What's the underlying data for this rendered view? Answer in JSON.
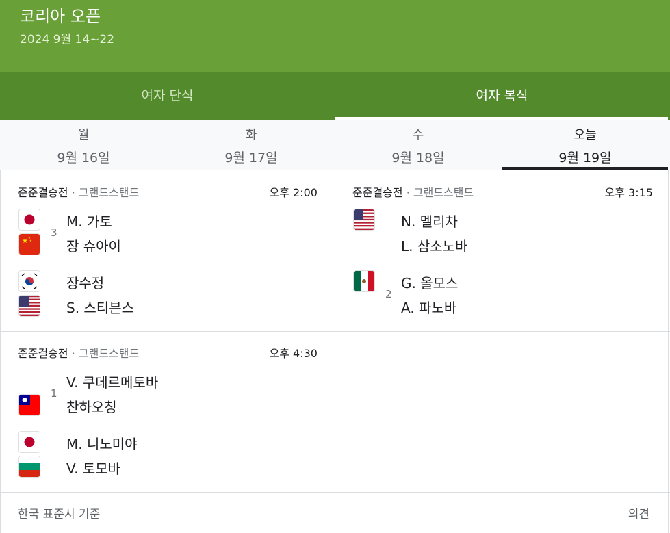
{
  "header": {
    "title": "코리아 오픈",
    "dates": "2024 9월 14~22"
  },
  "tabs": [
    {
      "label": "여자 단식",
      "active": false
    },
    {
      "label": "여자 복식",
      "active": true
    }
  ],
  "days": [
    {
      "name": "월",
      "date": "9월 16일",
      "active": false
    },
    {
      "name": "화",
      "date": "9월 17일",
      "active": false
    },
    {
      "name": "수",
      "date": "9월 18일",
      "active": false
    },
    {
      "name": "오늘",
      "date": "9월 19일",
      "active": true
    }
  ],
  "matches": [
    {
      "stage": "준준결승전",
      "separator": "·",
      "venue": "그랜드스탠드",
      "time": "오후 2:00",
      "team1": {
        "seed": "3",
        "players": [
          {
            "name": "M. 가토",
            "flag": "japan-flag-icon"
          },
          {
            "name": "장 슈아이",
            "flag": "china-flag-icon"
          }
        ]
      },
      "team2": {
        "seed": "",
        "players": [
          {
            "name": "장수정",
            "flag": "south-korea-flag-icon"
          },
          {
            "name": "S. 스티븐스",
            "flag": "usa-flag-icon"
          }
        ]
      }
    },
    {
      "stage": "준준결승전",
      "separator": "·",
      "venue": "그랜드스탠드",
      "time": "오후 3:15",
      "team1": {
        "seed": "",
        "players": [
          {
            "name": "N. 멜리차",
            "flag": "usa-flag-icon"
          },
          {
            "name": "L. 삼소노바",
            "flag": ""
          }
        ]
      },
      "team2": {
        "seed": "2",
        "players": [
          {
            "name": "G. 올모스",
            "flag": "mexico-flag-icon"
          },
          {
            "name": "A. 파노바",
            "flag": ""
          }
        ]
      }
    },
    {
      "stage": "준준결승전",
      "separator": "·",
      "venue": "그랜드스탠드",
      "time": "오후 4:30",
      "team1": {
        "seed": "1",
        "players": [
          {
            "name": "V. 쿠데르메토바",
            "flag": ""
          },
          {
            "name": "찬하오칭",
            "flag": "taiwan-flag-icon"
          }
        ]
      },
      "team2": {
        "seed": "",
        "players": [
          {
            "name": "M. 니노미야",
            "flag": "japan-flag-icon"
          },
          {
            "name": "V. 토모바",
            "flag": "bulgaria-flag-icon"
          }
        ]
      }
    }
  ],
  "footer": {
    "timezone": "한국 표준시 기준",
    "feedback": "의견"
  },
  "colors": {
    "header_green": "#6aa038",
    "tab_green": "#528a2c"
  }
}
